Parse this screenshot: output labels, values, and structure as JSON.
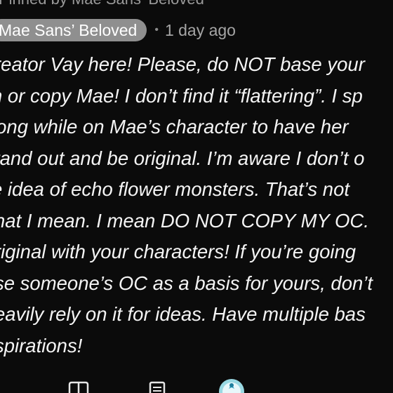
{
  "pinned": {
    "text": "Pinned by Mae Sans' Beloved"
  },
  "comment": {
    "author": "Mae Sans’ Beloved",
    "separator": "•",
    "time": "1 day ago",
    "lines": [
      "reator Vay here! Please, do NOT base your",
      "n or copy Mae! I don’t find it “flattering”. I sp",
      "long while on Mae’s character to have her",
      "tand out and be original. I’m aware I don’t o",
      "e idea of echo flower monsters. That’s not",
      "hat I mean. I mean DO NOT COPY MY OC.",
      "riginal with your characters! If you’re going",
      "se someone’s OC as a basis for yours, don’t",
      "eavily rely on it for ideas. Have multiple bas",
      "spirations!"
    ]
  },
  "actions": [
    {
      "icon": "reply-bubble-icon"
    },
    {
      "icon": "note-icon"
    },
    {
      "icon": "creator-avatar-icon"
    }
  ],
  "colors": {
    "background": "#0b0b0b",
    "text": "#f4f4f4",
    "chip": "#8f8f8f",
    "meta": "#a5a5a5",
    "avatar_accent": "#7fd6e0"
  }
}
